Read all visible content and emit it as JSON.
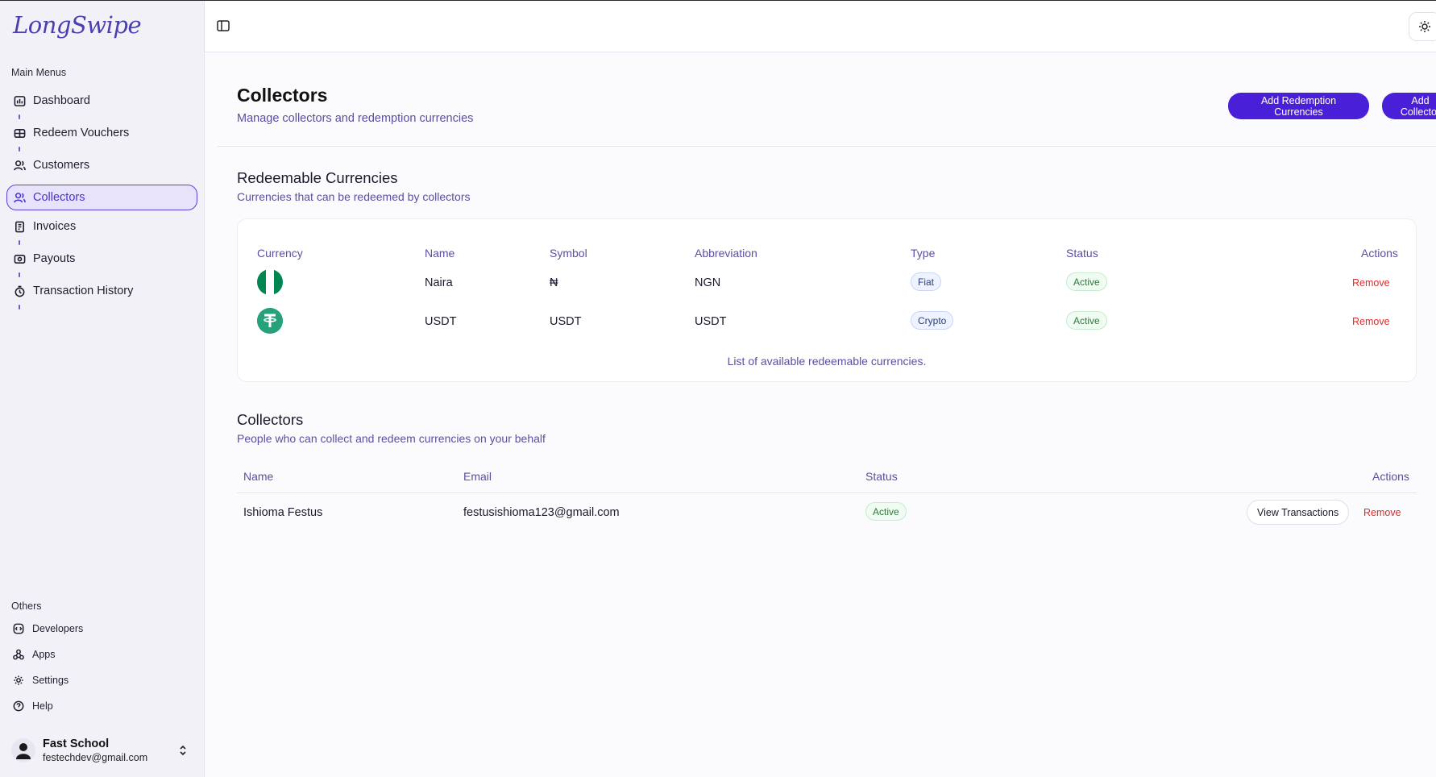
{
  "brand": {
    "logo_text": "LongSwipe"
  },
  "sidebar": {
    "main_label": "Main Menus",
    "items": [
      {
        "label": "Dashboard",
        "icon": "dashboard-icon"
      },
      {
        "label": "Redeem Vouchers",
        "icon": "voucher-icon"
      },
      {
        "label": "Customers",
        "icon": "users-icon"
      },
      {
        "label": "Collectors",
        "icon": "collectors-icon",
        "active": true
      },
      {
        "label": "Invoices",
        "icon": "invoice-icon"
      },
      {
        "label": "Payouts",
        "icon": "payout-icon"
      },
      {
        "label": "Transaction History",
        "icon": "history-icon"
      }
    ],
    "others_label": "Others",
    "others": [
      {
        "label": "Developers",
        "icon": "developers-icon"
      },
      {
        "label": "Apps",
        "icon": "apps-icon"
      },
      {
        "label": "Settings",
        "icon": "gear-icon"
      },
      {
        "label": "Help",
        "icon": "help-icon"
      }
    ],
    "profile": {
      "name": "Fast School",
      "email": "festechdev@gmail.com"
    }
  },
  "page": {
    "title": "Collectors",
    "subtitle": "Manage collectors and redemption currencies",
    "add_redemption_label": "Add Redemption Currencies",
    "add_collector_label": "Add Collector"
  },
  "currencies": {
    "title": "Redeemable Currencies",
    "subtitle": "Currencies that can be redeemed by collectors",
    "headers": {
      "currency": "Currency",
      "name": "Name",
      "symbol": "Symbol",
      "abbreviation": "Abbreviation",
      "type": "Type",
      "status": "Status",
      "actions": "Actions"
    },
    "rows": [
      {
        "icon": "nigeria-flag-icon",
        "name": "Naira",
        "symbol": "₦",
        "abbreviation": "NGN",
        "type": "Fiat",
        "status": "Active",
        "action": "Remove"
      },
      {
        "icon": "tether-icon",
        "name": "USDT",
        "symbol": "USDT",
        "abbreviation": "USDT",
        "type": "Crypto",
        "status": "Active",
        "action": "Remove"
      }
    ],
    "caption": "List of available redeemable currencies."
  },
  "collectors": {
    "title": "Collectors",
    "subtitle": "People who can collect and redeem currencies on your behalf",
    "headers": {
      "name": "Name",
      "email": "Email",
      "status": "Status",
      "actions": "Actions"
    },
    "rows": [
      {
        "name": "Ishioma Festus",
        "email": "festusishioma123@gmail.com",
        "status": "Active",
        "view_label": "View Transactions",
        "remove_label": "Remove"
      }
    ]
  },
  "colors": {
    "accent": "#4a1fd8",
    "danger": "#e02b2b",
    "muted_text": "#5b4fa0"
  }
}
